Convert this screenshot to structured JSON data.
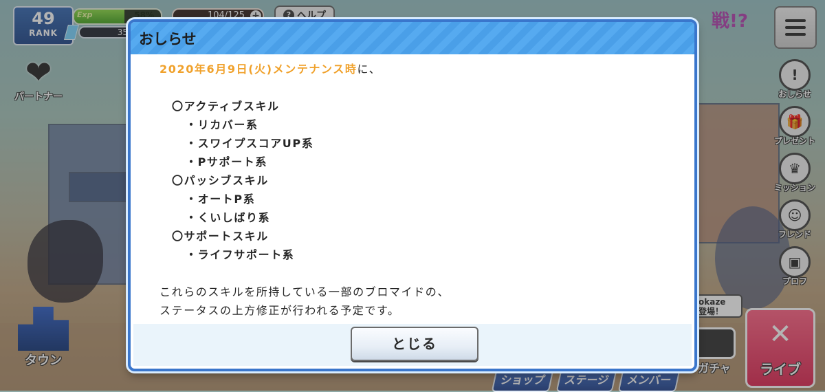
{
  "hud": {
    "rank_value": "49",
    "rank_label": "RANK",
    "exp_label": "Exp",
    "exp_percent": "58%",
    "exp_fill": 0.58,
    "coins": "35",
    "stamina": "104/125",
    "stamina_plus": "+",
    "help_label": "ヘルプ",
    "help_icon": "?",
    "menu_icon": "hamburger-menu-icon"
  },
  "left_menu": {
    "partner_label": "パートナー",
    "town_label": "タウン"
  },
  "right_menu": {
    "notice_label": "おしらせ",
    "notice_icon": "!",
    "present_label": "プレゼント",
    "mission_label": "ミッション",
    "friend_label": "フレンド",
    "profile_label": "プロフ"
  },
  "bottom_menu": {
    "shop_label": "ショップ",
    "stage_label": "ステージ",
    "member_label": "メンバー",
    "gacha_label": "ガチャ",
    "live_label": "ライブ",
    "bubble_text_1": "okaze",
    "bubble_text_2": "登場！"
  },
  "banner": {
    "text": "戦!?"
  },
  "modal": {
    "title": "おしらせ",
    "highlight": "2020年6月9日(火)メンテナンス時",
    "highlight_suffix": "に、",
    "items": [
      "〇アクティブスキル",
      "・リカバー系",
      "・スワイプスコアUP系",
      "・Pサポート系",
      "〇パッシブスキル",
      "・オートP系",
      "・くいしばり系",
      "〇サポートスキル",
      "・ライフサポート系"
    ],
    "paragraph_1": "これらのスキルを所持している一部のブロマイドの、",
    "paragraph_2": "ステータスの上方修正が行われる予定です。",
    "close_label": "とじる"
  },
  "colors": {
    "header_blue": "#4a9fe8",
    "highlight_orange": "#f0a12b",
    "frame_blue": "#3a76cc"
  }
}
